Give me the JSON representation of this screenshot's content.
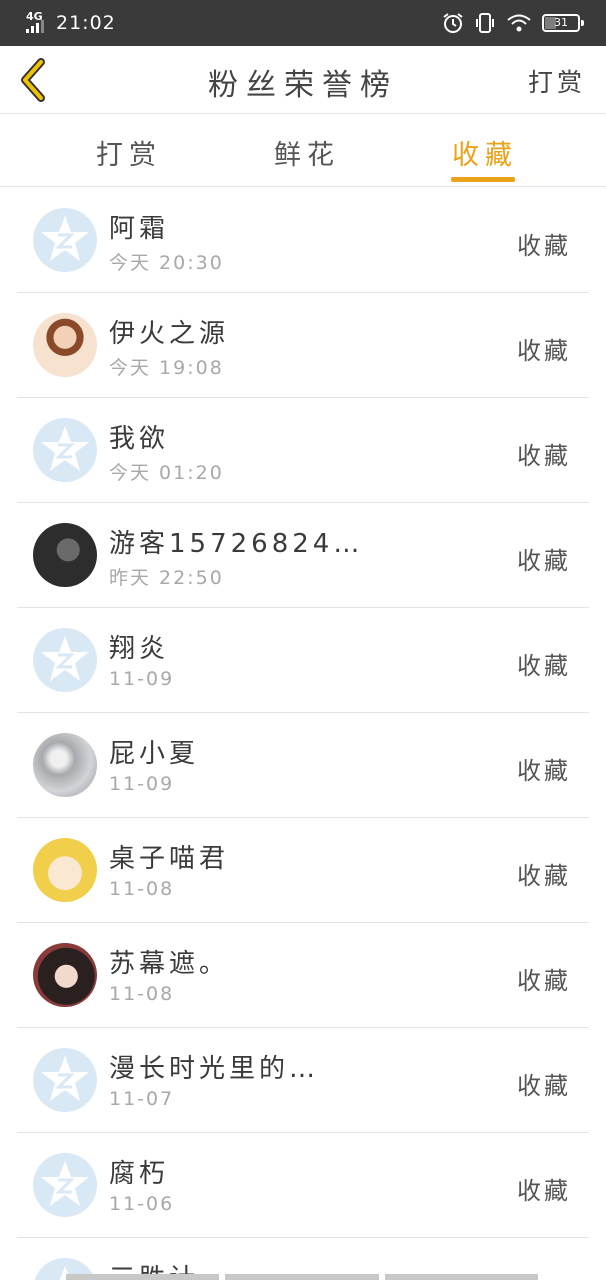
{
  "status_bar": {
    "network": "4G",
    "time": "21:02",
    "battery": "31"
  },
  "header": {
    "title": "粉丝荣誉榜",
    "right_action": "打赏"
  },
  "tabs": [
    {
      "label": "打赏",
      "active": false
    },
    {
      "label": "鲜花",
      "active": false
    },
    {
      "label": "收藏",
      "active": true
    }
  ],
  "colors": {
    "accent": "#e9a318",
    "status_bar_bg": "#3a3a3a"
  },
  "list": [
    {
      "name": "阿霜",
      "time": "今天 20:30",
      "action": "收藏",
      "avatar": "default-avatar"
    },
    {
      "name": "伊火之源",
      "time": "今天 19:08",
      "action": "收藏",
      "avatar": "user-avatar"
    },
    {
      "name": "我欲",
      "time": "今天 01:20",
      "action": "收藏",
      "avatar": "default-avatar"
    },
    {
      "name": "游客15726824…",
      "time": "昨天 22:50",
      "action": "收藏",
      "avatar": "user-avatar"
    },
    {
      "name": "翔炎",
      "time": "11-09",
      "action": "收藏",
      "avatar": "default-avatar"
    },
    {
      "name": "屁小夏",
      "time": "11-09",
      "action": "收藏",
      "avatar": "user-avatar"
    },
    {
      "name": "桌子喵君",
      "time": "11-08",
      "action": "收藏",
      "avatar": "user-avatar"
    },
    {
      "name": "苏幕遮。",
      "time": "11-08",
      "action": "收藏",
      "avatar": "user-avatar"
    },
    {
      "name": "漫长时光里的…",
      "time": "11-07",
      "action": "收藏",
      "avatar": "default-avatar"
    },
    {
      "name": "腐朽",
      "time": "11-06",
      "action": "收藏",
      "avatar": "default-avatar"
    }
  ],
  "partial_row": {
    "name": "三胜计",
    "avatar": "default-avatar"
  }
}
